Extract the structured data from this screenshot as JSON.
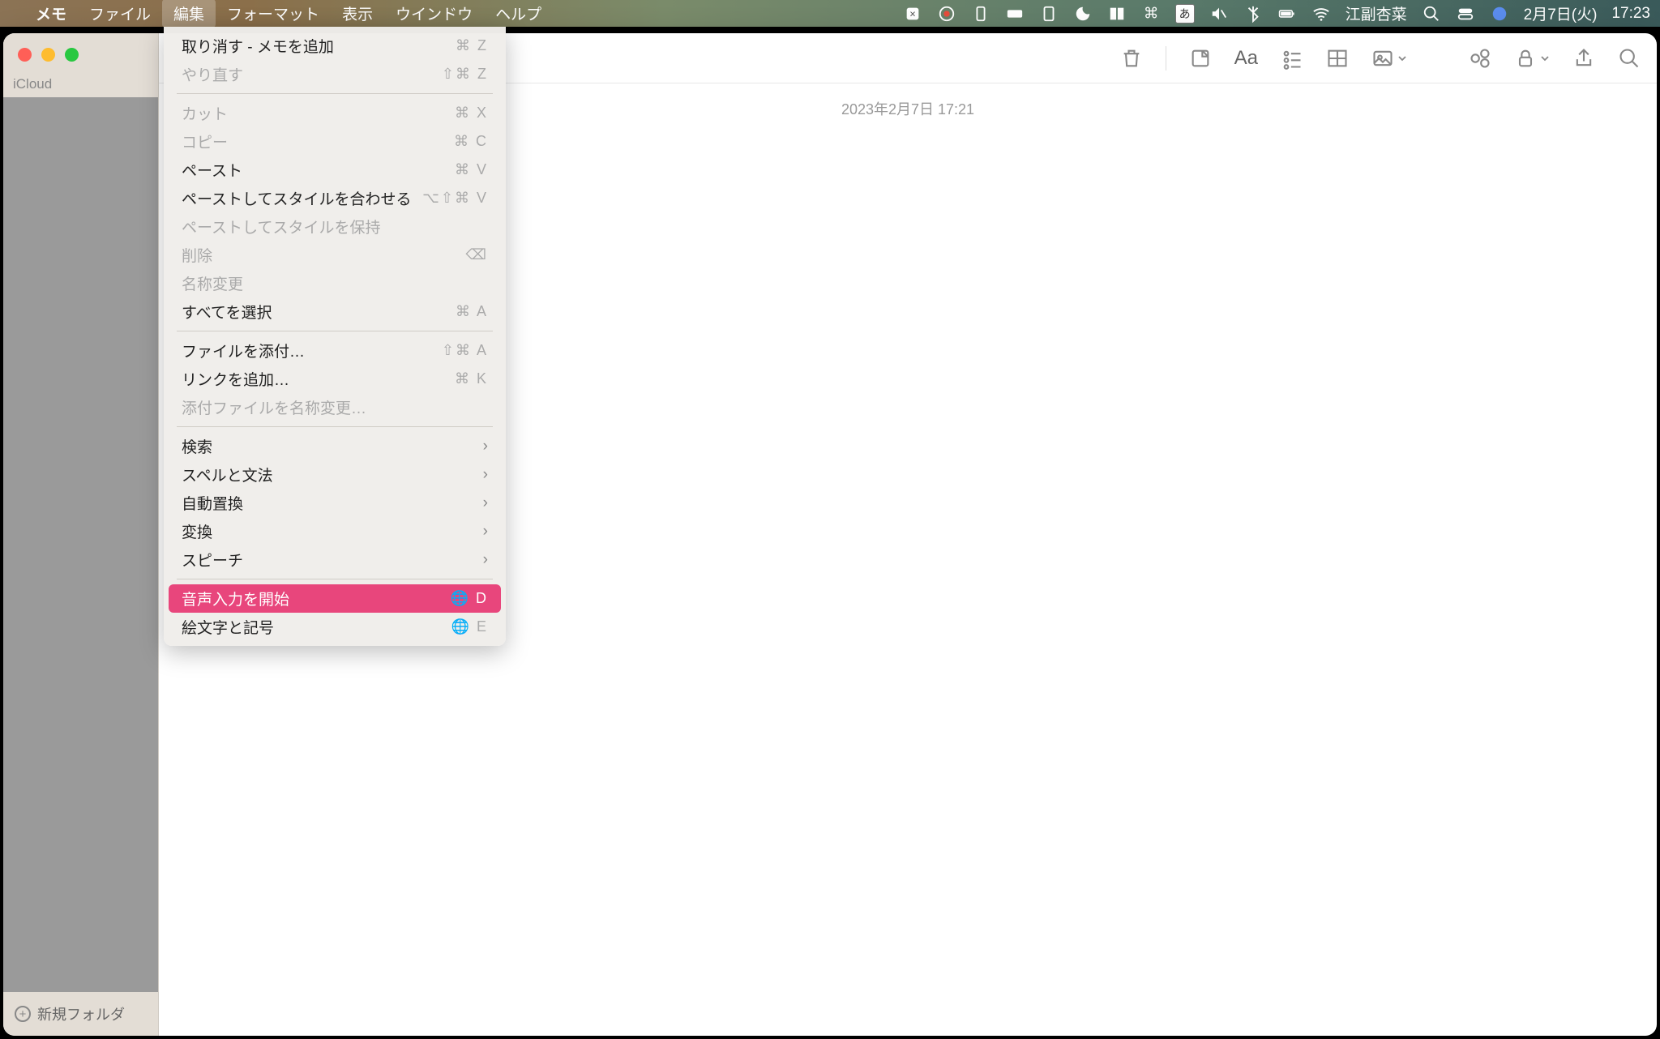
{
  "menubar": {
    "app": "メモ",
    "items": [
      "ファイル",
      "編集",
      "フォーマット",
      "表示",
      "ウインドウ",
      "ヘルプ"
    ],
    "active_index": 1,
    "username": "江副杏菜",
    "date": "2月7日(火)",
    "time": "17:23",
    "ime_indicator": "あ"
  },
  "sidebar": {
    "section": "iCloud",
    "footer": "新規フォルダ"
  },
  "note": {
    "timestamp": "2023年2月7日 17:21"
  },
  "toolbar": {
    "format_label": "Aa"
  },
  "dropdown": {
    "groups": [
      [
        {
          "label": "取り消す - メモを追加",
          "shortcut": "⌘ Z",
          "disabled": false
        },
        {
          "label": "やり直す",
          "shortcut": "⇧⌘ Z",
          "disabled": true
        }
      ],
      [
        {
          "label": "カット",
          "shortcut": "⌘ X",
          "disabled": true
        },
        {
          "label": "コピー",
          "shortcut": "⌘ C",
          "disabled": true
        },
        {
          "label": "ペースト",
          "shortcut": "⌘ V",
          "disabled": false
        },
        {
          "label": "ペーストしてスタイルを合わせる",
          "shortcut": "⌥⇧⌘ V",
          "disabled": false
        },
        {
          "label": "ペーストしてスタイルを保持",
          "shortcut": "",
          "disabled": true
        },
        {
          "label": "削除",
          "shortcut": "⌫",
          "disabled": true
        },
        {
          "label": "名称変更",
          "shortcut": "",
          "disabled": true
        },
        {
          "label": "すべてを選択",
          "shortcut": "⌘ A",
          "disabled": false
        }
      ],
      [
        {
          "label": "ファイルを添付…",
          "shortcut": "⇧⌘ A",
          "disabled": false
        },
        {
          "label": "リンクを追加…",
          "shortcut": "⌘ K",
          "disabled": false
        },
        {
          "label": "添付ファイルを名称変更…",
          "shortcut": "",
          "disabled": true
        }
      ],
      [
        {
          "label": "検索",
          "submenu": true,
          "disabled": false
        },
        {
          "label": "スペルと文法",
          "submenu": true,
          "disabled": false
        },
        {
          "label": "自動置換",
          "submenu": true,
          "disabled": false
        },
        {
          "label": "変換",
          "submenu": true,
          "disabled": false
        },
        {
          "label": "スピーチ",
          "submenu": true,
          "disabled": false
        }
      ],
      [
        {
          "label": "音声入力を開始",
          "shortcut": "🌐 D",
          "disabled": false,
          "highlighted": true
        },
        {
          "label": "絵文字と記号",
          "shortcut": "🌐 E",
          "disabled": false
        }
      ]
    ]
  }
}
